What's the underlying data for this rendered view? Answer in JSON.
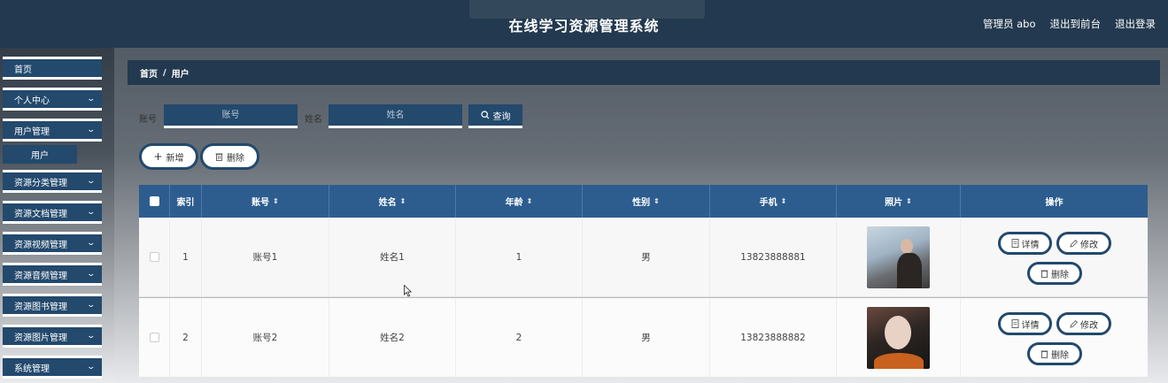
{
  "header": {
    "title": "在线学习资源管理系统",
    "user_label": "管理员 abo",
    "front_link": "退出到前台",
    "logout": "退出登录"
  },
  "sidebar": {
    "items": [
      {
        "label": "首页",
        "has_chevron": false
      },
      {
        "label": "个人中心",
        "has_chevron": true
      },
      {
        "label": "用户管理",
        "has_chevron": true
      },
      {
        "label": "资源分类管理",
        "has_chevron": true
      },
      {
        "label": "资源文档管理",
        "has_chevron": true
      },
      {
        "label": "资源视频管理",
        "has_chevron": true
      },
      {
        "label": "资源音频管理",
        "has_chevron": true
      },
      {
        "label": "资源图书管理",
        "has_chevron": true
      },
      {
        "label": "资源图片管理",
        "has_chevron": true
      },
      {
        "label": "系统管理",
        "has_chevron": true
      }
    ],
    "submenu": {
      "label": "用户"
    }
  },
  "breadcrumb": {
    "home": "首页",
    "separator": "/",
    "current": "用户"
  },
  "search": {
    "account_label": "账号",
    "account_placeholder": "账号",
    "name_label": "姓名",
    "name_placeholder": "姓名",
    "query_button": "查询"
  },
  "actions": {
    "add": "新增",
    "delete": "删除"
  },
  "table": {
    "columns": [
      "索引",
      "账号",
      "姓名",
      "年龄",
      "性别",
      "手机",
      "照片",
      "操作"
    ],
    "rows": [
      {
        "index": "1",
        "account": "账号1",
        "name": "姓名1",
        "age": "1",
        "gender": "男",
        "phone": "13823888881"
      },
      {
        "index": "2",
        "account": "账号2",
        "name": "姓名2",
        "age": "2",
        "gender": "男",
        "phone": "13823888882"
      }
    ],
    "row_actions": {
      "detail": "详情",
      "edit": "修改",
      "delete": "删除"
    }
  },
  "colors": {
    "primary": "#23496d",
    "header_bg": "#23394f",
    "table_header": "#2c5d8e"
  }
}
